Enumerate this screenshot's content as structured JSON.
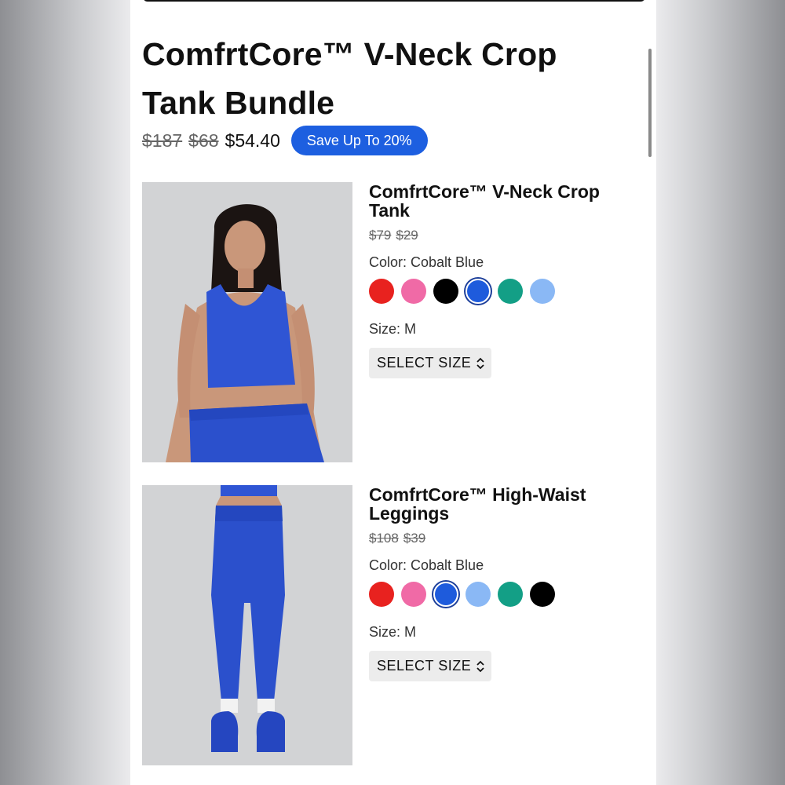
{
  "bundle": {
    "title": "ComfrtCore™ V-Neck Crop Tank Bundle",
    "original_price": "$187",
    "sale_price": "$68",
    "final_price": "$54.40",
    "save_badge": "Save Up To 20%"
  },
  "products": [
    {
      "name": "ComfrtCore™ V-Neck Crop Tank",
      "original_price": "$79",
      "sale_price": "$29",
      "color_label": "Color: Cobalt Blue",
      "size_label": "Size: M",
      "select_size": "SELECT SIZE",
      "swatches": [
        "#e8221f",
        "#f06aa6",
        "#000000",
        "#1e5bdc",
        "#139f86",
        "#8ab8f5"
      ],
      "selected_swatch": 3
    },
    {
      "name": "ComfrtCore™ High-Waist Leggings",
      "original_price": "$108",
      "sale_price": "$39",
      "color_label": "Color: Cobalt Blue",
      "size_label": "Size: M",
      "select_size": "SELECT SIZE",
      "swatches": [
        "#e8221f",
        "#f06aa6",
        "#1e5bdc",
        "#8ab8f5",
        "#139f86",
        "#000000"
      ],
      "selected_swatch": 2
    }
  ],
  "colors": {
    "accent": "#1d5fe0",
    "product": "#2f55d4"
  }
}
